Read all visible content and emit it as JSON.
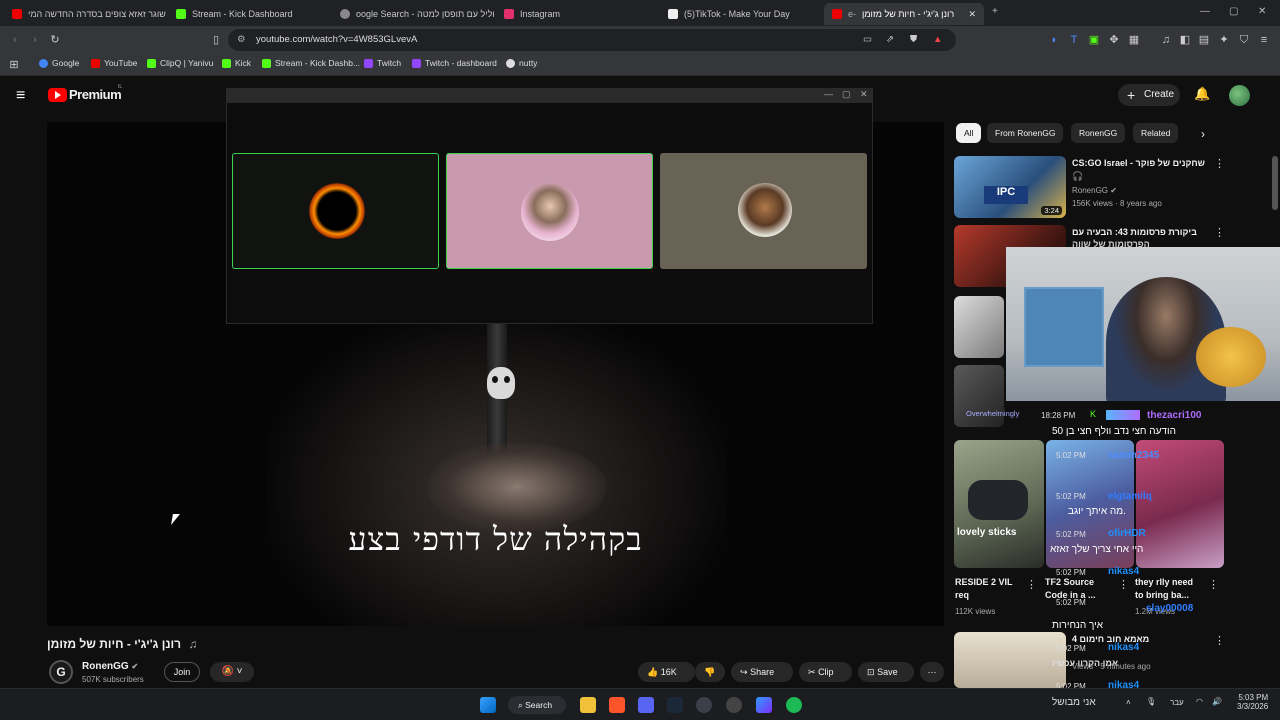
{
  "browser": {
    "tabs": [
      {
        "label": "שוגר זאזא צופים בסדרה החדשה המי",
        "favicon_color": "#e00"
      },
      {
        "label": "Stream - Kick Dashboard",
        "favicon_color": "#53fc18"
      },
      {
        "label": "oogle Search - חליל עם תופסן למטה",
        "favicon_color": "#888"
      },
      {
        "label": "Instagram",
        "favicon_color": "#e1306c"
      },
      {
        "label": "(5)TikTok - Make Your Day",
        "favicon_color": "#eee"
      },
      {
        "label": "רונן ג'יג'י - חיות של מזומן",
        "favicon_color": "#e00",
        "prefix": "e-"
      }
    ],
    "new_tab": "+",
    "url": "youtube.com/watch?v=4W853GLvevA",
    "bookmarks": [
      {
        "label": "Google",
        "color": "#4285f4"
      },
      {
        "label": "YouTube",
        "color": "#e00"
      },
      {
        "label": "ClipQ | Yanivu",
        "color": "#53fc18"
      },
      {
        "label": "Kick",
        "color": "#53fc18"
      },
      {
        "label": "Stream - Kick Dashb...",
        "color": "#53fc18"
      },
      {
        "label": "Twitch",
        "color": "#9146ff"
      },
      {
        "label": "Twitch - dashboard",
        "color": "#9146ff"
      },
      {
        "label": "nutty",
        "color": "#ddd"
      }
    ]
  },
  "youtube": {
    "logo": "Premium",
    "logo_region": "IL",
    "create_label": "Create",
    "chips": [
      "All",
      "From RonenGG",
      "RonenGG",
      "Related"
    ],
    "subtitle_text": "בקהילה של דודפי בצע",
    "video_title": "רונן ג'יג'י - חיות של מזומן",
    "channel": "RonenGG",
    "subscribers": "507K subscribers",
    "join_label": "Join",
    "likes": "16K",
    "share_label": "Share",
    "clip_label": "Clip",
    "save_label": "Save",
    "recommendations": [
      {
        "title": "CS:GO Israel - שחקנים של פוקר",
        "channel": "RonenGG",
        "meta": "156K views · 8 years ago",
        "duration": "3:24"
      },
      {
        "title": "ביקורת פרסומות 43: הבעיה עם",
        "line2": "הפרסומות של שווה"
      },
      {
        "title": "RESIDE 2 VIL",
        "line2": "req",
        "meta": "112K views"
      },
      {
        "title": "TF2 Source",
        "line2": "Code in a ..."
      },
      {
        "title": "they rlly need",
        "line2": "to bring ba...",
        "meta": "1.2M views"
      },
      {
        "title": "מאמא חוב חימום 4",
        "line2": "אמן הקרוו עכשיו",
        "meta": "Views · 5 minutes ago"
      }
    ]
  },
  "stream_overlay": {
    "overwhelmingly": "Overwhelmingly",
    "chat": [
      {
        "time": "18:28 PM",
        "user": "thezacri100",
        "msg": "הודעה חצי נדב וולף חצי בן 50",
        "color": "#b06cff"
      },
      {
        "time": "5:02 PM",
        "user": "samm2345",
        "msg": "",
        "color": "#4c8dff"
      },
      {
        "time": "5:02 PM",
        "user": "elgtamilq",
        "msg": "מה איתך יוגב.",
        "color": "#2f7bff"
      },
      {
        "time": "5:02 PM",
        "user": "ofirHDR",
        "msg": "היי אחי צריך שלך זאזא",
        "color": "#1e90ff"
      },
      {
        "time": "5:02 PM",
        "user": "nikas4",
        "msg": "איך הנחירות",
        "color": "#1e90ff"
      },
      {
        "time": "5:02 PM",
        "user": "slay00008",
        "msg": "",
        "color": "#2f7bff"
      },
      {
        "time": "5:02 PM",
        "user": "nikas4",
        "msg": "",
        "color": "#1e90ff"
      },
      {
        "time": "5:02 PM",
        "user": "nikas4",
        "msg": "",
        "color": "#1e90ff"
      }
    ],
    "tiktok_label": "lovely sticks"
  },
  "taskbar": {
    "search_label": "Search",
    "tray_text": "אני מבושל",
    "lang": "עבר",
    "time": "5:03 PM",
    "date": "3/3/2026"
  }
}
